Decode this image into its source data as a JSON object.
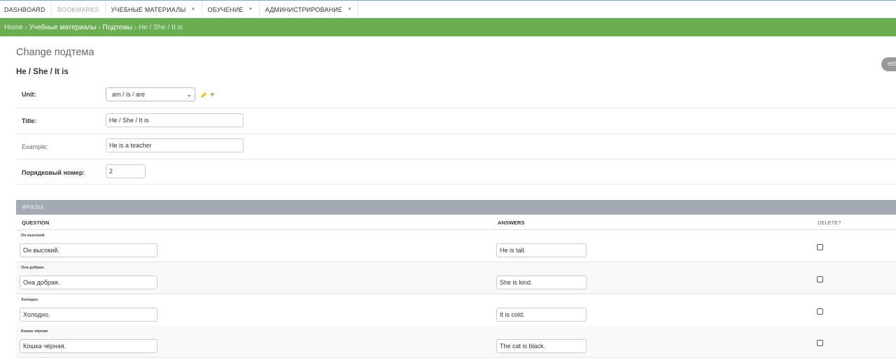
{
  "topnav": {
    "items": [
      {
        "label": "DASHBOARD"
      },
      {
        "label": "BOOKMARKS"
      },
      {
        "label": "УЧЕБНЫЕ МАТЕРИАЛЫ",
        "dropdown_icon": "caret-down-icon"
      },
      {
        "label": "ОБУЧЕНИЕ",
        "dropdown_icon": "caret-down-icon"
      },
      {
        "label": "АДМИНИСТРИРОВАНИЕ",
        "dropdown_icon": "caret-down-icon"
      }
    ]
  },
  "breadcrumbs": {
    "home": "Home",
    "section": "Учебные материалы",
    "model": "Подтемы",
    "current": "He / She / It is",
    "separator": "›"
  },
  "page": {
    "title": "Change подтема",
    "object_title": "He / She / It is",
    "history_button": "HIS"
  },
  "form": {
    "unit": {
      "label": "Unit:",
      "value": "am / is / are",
      "arrow": "⌄"
    },
    "title": {
      "label": "Title:",
      "value": "He / She / It is"
    },
    "example": {
      "label": "Example:",
      "value": "He is a teacher"
    },
    "order": {
      "label": "Порядковый номер:",
      "value": "2"
    },
    "plus_glyph": "+"
  },
  "inline": {
    "title": "ФРАЗЫ",
    "columns": {
      "question": "QUESTION",
      "answers": "ANSWERS",
      "delete": "DELETE?"
    },
    "rows": [
      {
        "original": "Он высокий.",
        "question": "Он высокий.",
        "answer": "He is tall.",
        "delete": false
      },
      {
        "original": "Она добрая.",
        "question": "Она добрая.",
        "answer": "She is kind.",
        "delete": false
      },
      {
        "original": "Холодно.",
        "question": "Холодно.",
        "answer": "It is cold.",
        "delete": false
      },
      {
        "original": "Кошка чёрная.",
        "question": "Кошка чёрная.",
        "answer": "The cat is black.",
        "delete": false
      }
    ]
  },
  "colors": {
    "breadcrumb_bg": "#6aad53",
    "inline_header_bg": "#a3aab3",
    "add_icon": "#70bf2b",
    "edit_icon": "#efb80b"
  }
}
